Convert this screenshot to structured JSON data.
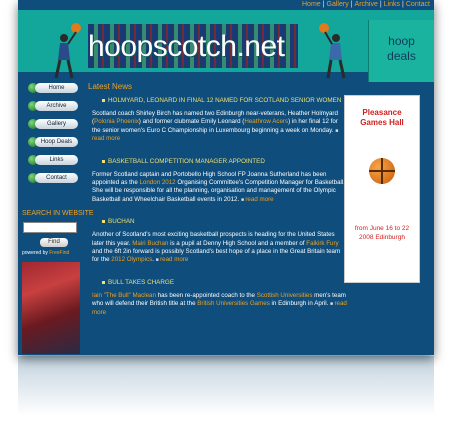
{
  "topnav": {
    "items": [
      "Home",
      "Gallery",
      "Archive",
      "Links",
      "Contact"
    ]
  },
  "banner": {
    "logo": "hoopscotch.net",
    "hoopdeals": [
      "hoop",
      "deals"
    ]
  },
  "sidebar": {
    "items": [
      "Home",
      "Archive",
      "Gallery",
      "Hoop Deals",
      "Links",
      "Contact"
    ]
  },
  "search": {
    "label": "SEARCH IN WEBSITE",
    "button": "Find",
    "powered": "powered by",
    "engine": "FreeFind"
  },
  "main": {
    "section_title": "Latest News",
    "articles": [
      {
        "headline": "HOLMYARD, LEONARD IN FINAL 12 NAMED FOR SCOTLAND SENIOR WOMEN",
        "p1": "Scotland coach Shirley Birch has named two Edinburgh near-veterans, Heather Holmyard (",
        "l1": "Polonia Phoenix",
        "p2": ") and former clubmate Emily Leonard (",
        "l2": "Heathrow Acers",
        "p3": ") in her final 12 for the senior women's Euro C Championship in Luxembourg beginning a week on Monday.",
        "more": "read more"
      },
      {
        "headline": "BASKETBALL COMPETITION MANAGER APPOINTED",
        "p1": "Former Scotland captain and Portobello High School FP Joanna Sutherland has been appointed as the ",
        "l1": "London 2012",
        "p2": " Organising Committee's Competition Manager for Basketball. She will be responsible for all the planning, organisation and management of the Olympic Basketball and Wheelchair Basketball events in 2012.",
        "more": "read more"
      },
      {
        "headline": "BUCHAN",
        "p1": "Another of Scotland's most exciting basketball prospects is heading for the United States later this year. ",
        "l1": "Mairi Buchan",
        "p2": " is a pupil at Denny High School and a member of ",
        "l2": "Falkirk Fury",
        "p3": " and the 6ft 2in forward is possibly Scotland's best hope of a place in the Great Britain team for the ",
        "l3": "2012 Olympics",
        "p4": ".",
        "more": "read more"
      },
      {
        "headline": "BULL TAKES CHARGE",
        "l1": "Iain \"The Bull\" Maclean",
        "p1": " has been re-appointed coach to the ",
        "l2": "Scottish Universities",
        "p2": " men's team who will defend their British title at the ",
        "l3": "British Universities Games",
        "p3": " in Edinburgh in April.",
        "more": "read more"
      }
    ]
  },
  "ad": {
    "title": [
      "Pleasance",
      "Games Hall"
    ],
    "dates": [
      "from June 16 to 22",
      "2008 Edinburgh"
    ]
  }
}
